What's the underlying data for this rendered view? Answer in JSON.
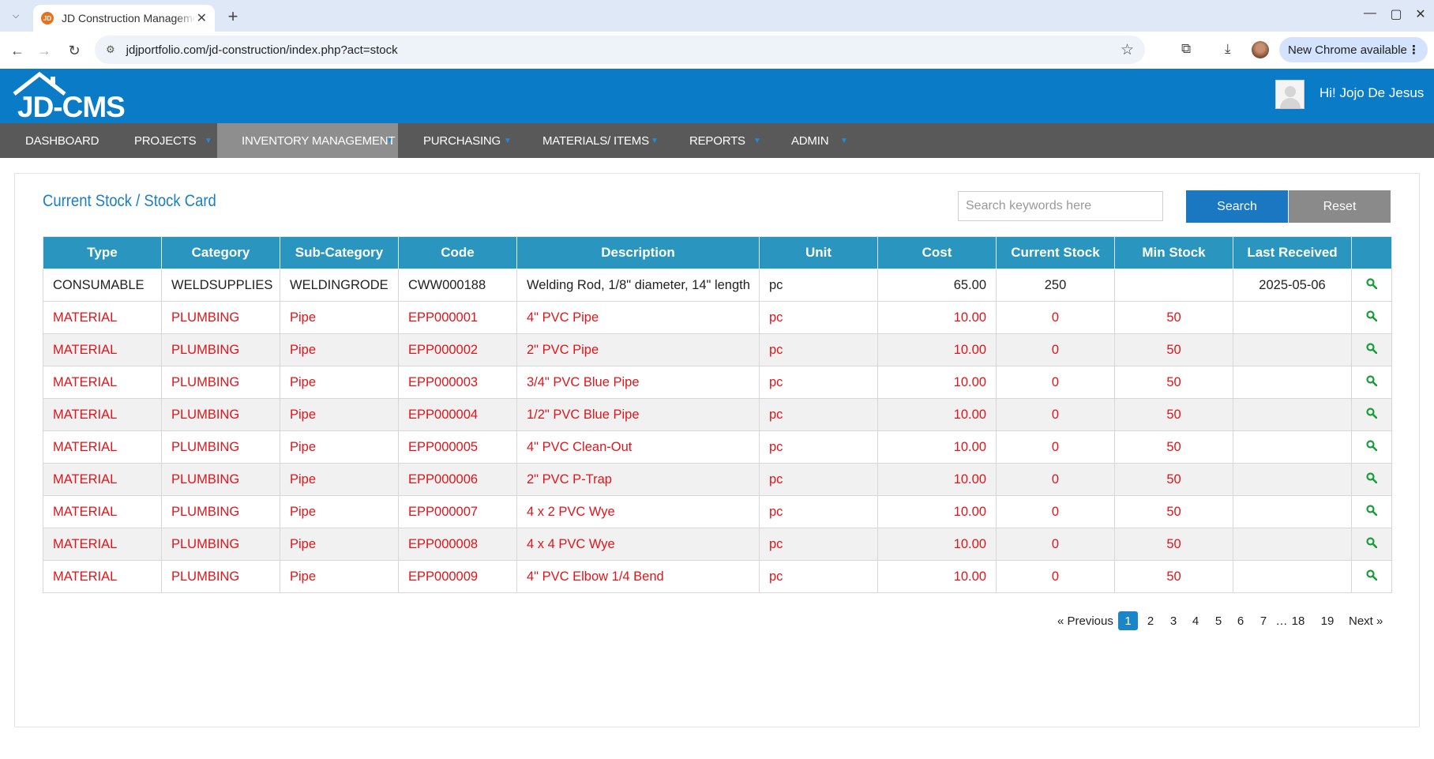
{
  "browser": {
    "tab_title": "JD Construction Management",
    "url": "jdjportfolio.com/jd-construction/index.php?act=stock",
    "update_label": "New Chrome available"
  },
  "app": {
    "logo_text": "JD-CMS",
    "greeting": "Hi! Jojo De Jesus"
  },
  "nav": {
    "items": [
      {
        "label": "DASHBOARD"
      },
      {
        "label": "PROJECTS"
      },
      {
        "label": "INVENTORY MANAGEMENT"
      },
      {
        "label": "PURCHASING"
      },
      {
        "label": "MATERIALS/ ITEMS"
      },
      {
        "label": "REPORTS"
      },
      {
        "label": "ADMIN"
      }
    ],
    "active": "INVENTORY MANAGEMENT"
  },
  "page": {
    "title": "Current Stock / Stock Card",
    "search_placeholder": "Search keywords here",
    "search_label": "Search",
    "reset_label": "Reset"
  },
  "table": {
    "columns": [
      "Type",
      "Category",
      "Sub-Category",
      "Code",
      "Description",
      "Unit",
      "Cost",
      "Current Stock",
      "Min Stock",
      "Last Received",
      ""
    ],
    "rows": [
      {
        "type": "CONSUMABLE",
        "category": "WELDSUPPLIES",
        "subcategory": "WELDINGRODE",
        "code": "CWW000188",
        "description": "Welding Rod, 1/8\" diameter, 14\" length",
        "unit": "pc",
        "cost": "65.00",
        "current_stock": "250",
        "min_stock": "",
        "last_received": "2025-05-06",
        "low": false
      },
      {
        "type": "MATERIAL",
        "category": "PLUMBING",
        "subcategory": "Pipe",
        "code": "EPP000001",
        "description": "4\" PVC Pipe",
        "unit": "pc",
        "cost": "10.00",
        "current_stock": "0",
        "min_stock": "50",
        "last_received": "",
        "low": true
      },
      {
        "type": "MATERIAL",
        "category": "PLUMBING",
        "subcategory": "Pipe",
        "code": "EPP000002",
        "description": "2\" PVC Pipe",
        "unit": "pc",
        "cost": "10.00",
        "current_stock": "0",
        "min_stock": "50",
        "last_received": "",
        "low": true
      },
      {
        "type": "MATERIAL",
        "category": "PLUMBING",
        "subcategory": "Pipe",
        "code": "EPP000003",
        "description": "3/4\" PVC Blue Pipe",
        "unit": "pc",
        "cost": "10.00",
        "current_stock": "0",
        "min_stock": "50",
        "last_received": "",
        "low": true
      },
      {
        "type": "MATERIAL",
        "category": "PLUMBING",
        "subcategory": "Pipe",
        "code": "EPP000004",
        "description": "1/2\" PVC Blue Pipe",
        "unit": "pc",
        "cost": "10.00",
        "current_stock": "0",
        "min_stock": "50",
        "last_received": "",
        "low": true
      },
      {
        "type": "MATERIAL",
        "category": "PLUMBING",
        "subcategory": "Pipe",
        "code": "EPP000005",
        "description": "4\" PVC Clean-Out",
        "unit": "pc",
        "cost": "10.00",
        "current_stock": "0",
        "min_stock": "50",
        "last_received": "",
        "low": true
      },
      {
        "type": "MATERIAL",
        "category": "PLUMBING",
        "subcategory": "Pipe",
        "code": "EPP000006",
        "description": "2\" PVC P-Trap",
        "unit": "pc",
        "cost": "10.00",
        "current_stock": "0",
        "min_stock": "50",
        "last_received": "",
        "low": true
      },
      {
        "type": "MATERIAL",
        "category": "PLUMBING",
        "subcategory": "Pipe",
        "code": "EPP000007",
        "description": "4 x 2 PVC Wye",
        "unit": "pc",
        "cost": "10.00",
        "current_stock": "0",
        "min_stock": "50",
        "last_received": "",
        "low": true
      },
      {
        "type": "MATERIAL",
        "category": "PLUMBING",
        "subcategory": "Pipe",
        "code": "EPP000008",
        "description": "4 x 4 PVC Wye",
        "unit": "pc",
        "cost": "10.00",
        "current_stock": "0",
        "min_stock": "50",
        "last_received": "",
        "low": true
      },
      {
        "type": "MATERIAL",
        "category": "PLUMBING",
        "subcategory": "Pipe",
        "code": "EPP000009",
        "description": "4\" PVC Elbow 1/4 Bend",
        "unit": "pc",
        "cost": "10.00",
        "current_stock": "0",
        "min_stock": "50",
        "last_received": "",
        "low": true
      }
    ],
    "row_action_icon": "magnifier-icon"
  },
  "pagination": {
    "previous": "« Previous",
    "pages": [
      "1",
      "2",
      "3",
      "4",
      "5",
      "6",
      "7",
      "…",
      "18",
      "19"
    ],
    "current": "1",
    "next": "Next »"
  },
  "colors": {
    "header_blue": "#0a7cc7",
    "nav_gray": "#595959",
    "table_header": "#2a95bf",
    "alert_red": "#e0151a",
    "view_green": "#1a9d3a"
  }
}
